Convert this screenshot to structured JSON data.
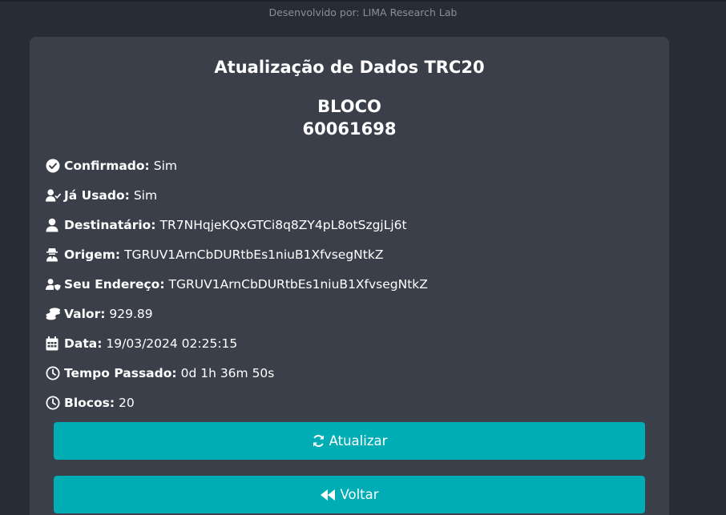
{
  "header": {
    "credit": "Desenvolvido por: LIMA Research Lab"
  },
  "card": {
    "title": "Atualização de Dados TRC20",
    "block_label": "BLOCO",
    "block_number": "60061698"
  },
  "details": [
    {
      "icon": "check-circle-icon",
      "label": "Confirmado:",
      "value": "Sim"
    },
    {
      "icon": "user-check-icon",
      "label": "Já Usado:",
      "value": "Sim"
    },
    {
      "icon": "user-icon",
      "label": "Destinatário:",
      "value": "TR7NHqjeKQxGTCi8q8ZY4pL8otSzgjLj6t"
    },
    {
      "icon": "user-secret-icon",
      "label": "Origem:",
      "value": "TGRUV1ArnCbDURtbEs1niuB1XfvsegNtkZ"
    },
    {
      "icon": "user-shield-icon",
      "label": "Seu Endereço:",
      "value": "TGRUV1ArnCbDURtbEs1niuB1XfvsegNtkZ"
    },
    {
      "icon": "coins-icon",
      "label": "Valor:",
      "value": "929.89"
    },
    {
      "icon": "calendar-icon",
      "label": "Data:",
      "value": "19/03/2024 02:25:15"
    },
    {
      "icon": "clock-icon",
      "label": "Tempo Passado:",
      "value": "0d 1h 36m 50s"
    },
    {
      "icon": "clock-icon",
      "label": "Blocos:",
      "value": "20"
    }
  ],
  "buttons": {
    "refresh_label": "Atualizar",
    "refresh_icon": "sync-icon",
    "back_label": "Voltar",
    "back_icon": "backward-icon"
  },
  "colors": {
    "background": "#282c34",
    "card": "#3a3f4a",
    "accent": "#00adb5",
    "text": "#ffffff",
    "muted": "#8a8f98"
  }
}
